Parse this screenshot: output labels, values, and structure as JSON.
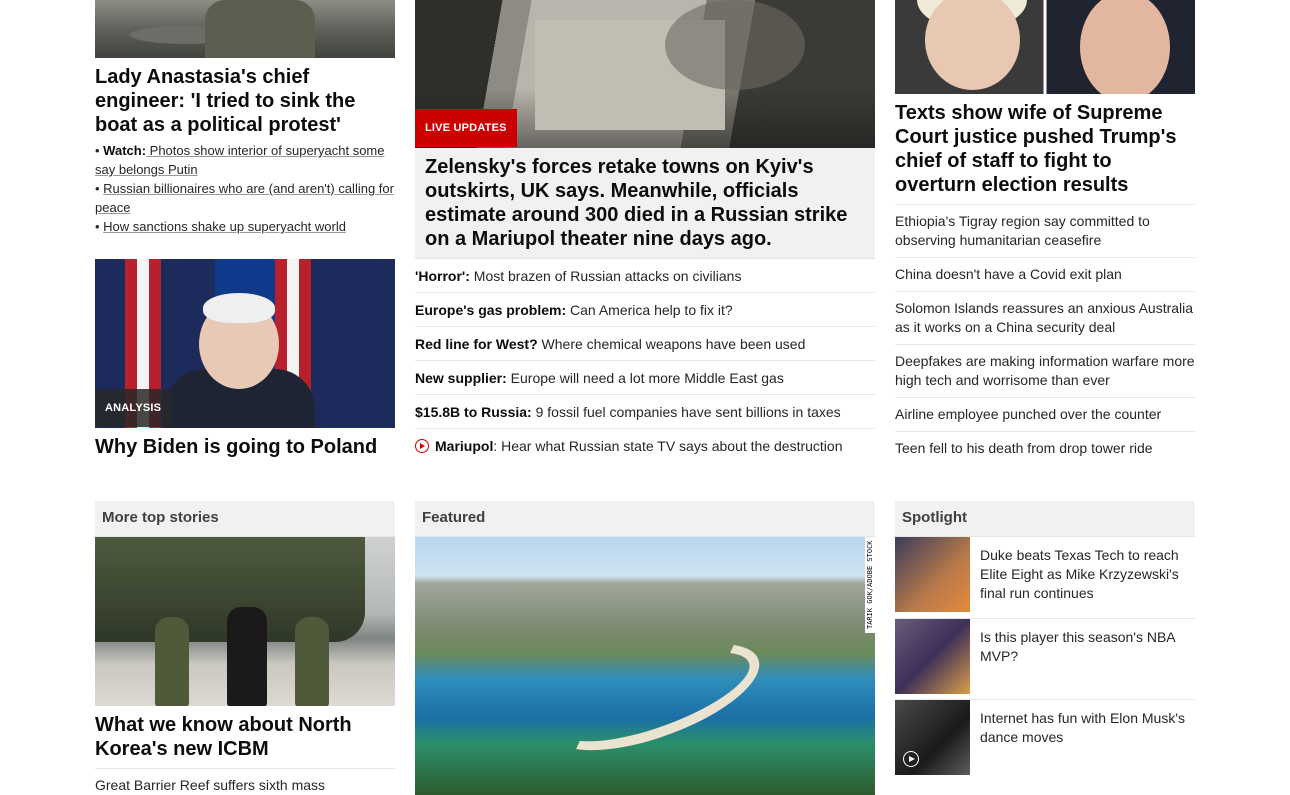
{
  "left_col": {
    "yacht_story": {
      "headline": "Lady Anastasia's chief engineer: 'I tried to sink the boat as a political protest'",
      "bullets": [
        {
          "prefix": "• ",
          "bold": "Watch:",
          "text": " Photos show interior of superyacht some say belongs Putin"
        },
        {
          "prefix": "• ",
          "bold": "",
          "text": "Russian billionaires who are (and aren't) calling for peace"
        },
        {
          "prefix": "• ",
          "bold": "",
          "text": "How sanctions shake up superyacht world"
        }
      ]
    },
    "biden_story": {
      "badge": "ANALYSIS",
      "headline": "Why Biden is going to Poland"
    }
  },
  "center_col": {
    "badge": "LIVE UPDATES",
    "headline": "Zelensky's forces retake towns on Kyiv's outskirts, UK says. Meanwhile, officials estimate around 300 died in a Russian strike on a Mariupol theater nine days ago.",
    "links": [
      {
        "bold": "'Horror':",
        "text": " Most brazen of Russian attacks on civilians"
      },
      {
        "bold": "Europe's gas problem:",
        "text": " Can America help to fix it?"
      },
      {
        "bold": "Red line for West?",
        "text": " Where chemical weapons have been used"
      },
      {
        "bold": "New supplier:",
        "text": " Europe will need a lot more Middle East gas"
      },
      {
        "bold": "$15.8B to Russia:",
        "text": " 9 fossil fuel companies have sent billions in taxes"
      },
      {
        "bold": "Mariupol",
        "text": ": Hear what Russian state TV says about the destruction"
      }
    ]
  },
  "right_col": {
    "headline": "Texts show wife of Supreme Court justice pushed Trump's chief of staff to fight to overturn election results",
    "links": [
      "Ethiopia's Tigray region say committed to observing humanitarian ceasefire",
      "China doesn't have a Covid exit plan",
      "Solomon Islands reassures an anxious Australia as it works on a China security deal",
      "Deepfakes are making information warfare more high tech and worrisome than ever",
      "Airline employee punched over the counter",
      "Teen fell to his death from drop tower ride"
    ]
  },
  "more_top_stories": {
    "title": "More top stories",
    "headline": "What we know about North Korea's new ICBM",
    "next_link": "Great Barrier Reef suffers sixth mass"
  },
  "featured": {
    "title": "Featured",
    "photo_credit": "TARIK GOK/ADOBE STOCK"
  },
  "spotlight": {
    "title": "Spotlight",
    "items": [
      {
        "text": "Duke beats Texas Tech to reach Elite Eight as Mike Krzyzewski's final run continues",
        "icon": "none"
      },
      {
        "text": "Is this player this season's NBA MVP?",
        "icon": "none"
      },
      {
        "text": "Internet has fun with Elon Musk's dance moves",
        "icon": "play-icon"
      }
    ]
  },
  "colors": {
    "live_badge": "#cc0000",
    "text": "#0c0c0c",
    "divider": "#e6e6e6",
    "section_bg": "#f1f1f1"
  }
}
